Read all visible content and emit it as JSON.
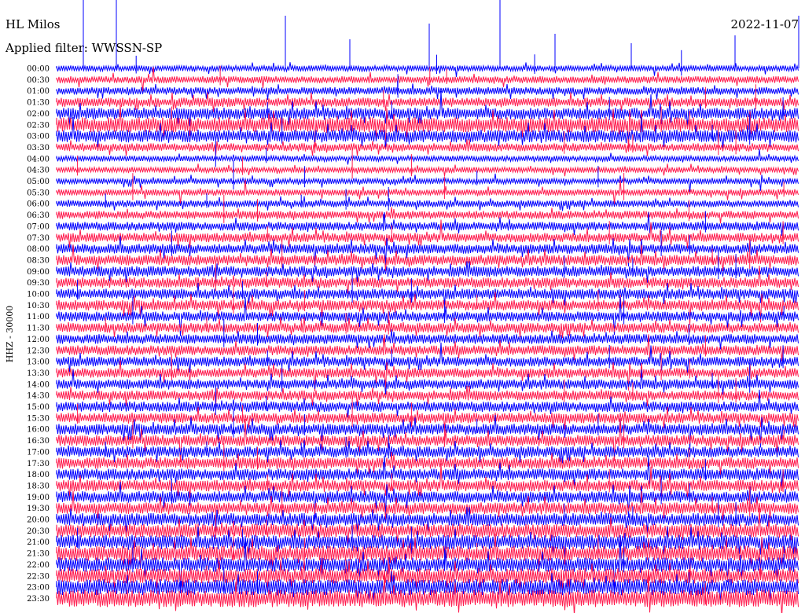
{
  "header": {
    "station": "HL Milos",
    "date": "2022-11-07",
    "filter": "Applied filter: WWSSN-SP",
    "channel_label": "HHZ - 30000"
  },
  "colors": {
    "trace_a": "#0000ff",
    "trace_b": "#ff1a4d",
    "background": "#ffffff",
    "text": "#000000"
  },
  "chart_data": {
    "type": "line",
    "title": "HL Milos",
    "subtitle": "Applied filter: WWSSN-SP",
    "ylabel": "HHZ - 30000",
    "xlabel": "",
    "grid": false,
    "legend": "none",
    "row_labels": [
      "00:00",
      "00:30",
      "01:00",
      "01:30",
      "02:00",
      "02:30",
      "03:00",
      "03:30",
      "04:00",
      "04:30",
      "05:00",
      "05:30",
      "06:00",
      "06:30",
      "07:00",
      "07:30",
      "08:00",
      "08:30",
      "09:00",
      "09:30",
      "10:00",
      "10:30",
      "11:00",
      "11:30",
      "12:00",
      "12:30",
      "13:00",
      "13:30",
      "14:00",
      "14:30",
      "15:00",
      "15:30",
      "16:00",
      "16:30",
      "17:00",
      "17:30",
      "18:00",
      "18:30",
      "19:00",
      "19:30",
      "20:00",
      "20:30",
      "21:00",
      "21:30",
      "22:00",
      "22:30",
      "23:00",
      "23:30"
    ],
    "row_colors": [
      "#0000ff",
      "#ff1a4d"
    ],
    "relative_noise_level": [
      1.0,
      1.2,
      1.3,
      1.6,
      2.0,
      2.6,
      2.2,
      1.4,
      1.0,
      1.0,
      1.0,
      1.1,
      1.2,
      1.4,
      1.5,
      1.6,
      1.7,
      1.8,
      1.8,
      1.8,
      1.8,
      1.8,
      1.7,
      1.7,
      1.7,
      1.7,
      1.7,
      1.7,
      1.7,
      1.7,
      1.8,
      1.8,
      1.9,
      1.9,
      1.9,
      2.0,
      2.0,
      2.0,
      2.0,
      2.0,
      2.2,
      2.4,
      2.5,
      2.6,
      2.5,
      2.6,
      2.8,
      3.0
    ]
  }
}
